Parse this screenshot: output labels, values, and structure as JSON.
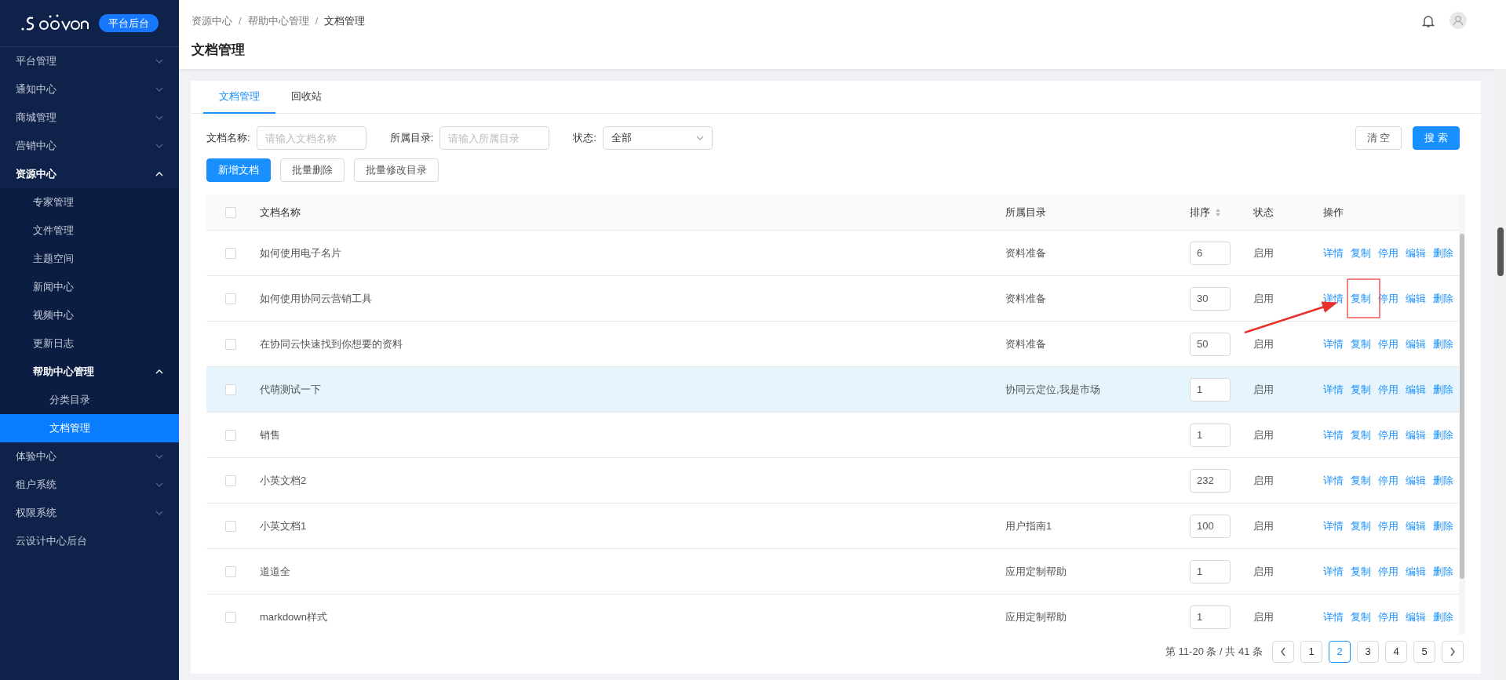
{
  "sidebar": {
    "logo_badge": "平台后台",
    "items": [
      {
        "label": "平台管理",
        "kind": "group",
        "expanded": false
      },
      {
        "label": "通知中心",
        "kind": "group",
        "expanded": false
      },
      {
        "label": "商城管理",
        "kind": "group",
        "expanded": false
      },
      {
        "label": "营销中心",
        "kind": "group",
        "expanded": false
      },
      {
        "label": "资源中心",
        "kind": "group",
        "expanded": true,
        "children": [
          {
            "label": "专家管理",
            "kind": "link",
            "selected": false
          },
          {
            "label": "文件管理",
            "kind": "link",
            "selected": false
          },
          {
            "label": "主题空间",
            "kind": "link",
            "selected": false
          },
          {
            "label": "新闻中心",
            "kind": "link",
            "selected": false
          },
          {
            "label": "视频中心",
            "kind": "link",
            "selected": false
          },
          {
            "label": "更新日志",
            "kind": "link",
            "selected": false
          },
          {
            "label": "帮助中心管理",
            "kind": "group",
            "expanded": true,
            "children": [
              {
                "label": "分类目录",
                "kind": "link",
                "selected": false
              },
              {
                "label": "文档管理",
                "kind": "link",
                "selected": true
              }
            ]
          }
        ]
      },
      {
        "label": "体验中心",
        "kind": "group",
        "expanded": false
      },
      {
        "label": "租户系统",
        "kind": "group",
        "expanded": false
      },
      {
        "label": "权限系统",
        "kind": "group",
        "expanded": false
      },
      {
        "label": "云设计中心后台",
        "kind": "link",
        "selected": false
      }
    ]
  },
  "header": {
    "breadcrumb": [
      "资源中心",
      "帮助中心管理",
      "文档管理"
    ],
    "separator": "/",
    "title": "文档管理"
  },
  "tabs": [
    {
      "label": "文档管理",
      "selected": true
    },
    {
      "label": "回收站",
      "selected": false
    }
  ],
  "filters": [
    {
      "kind": "input",
      "label": "文档名称:",
      "placeholder": "请输入文档名称"
    },
    {
      "kind": "input",
      "label": "所属目录:",
      "placeholder": "请输入所属目录"
    },
    {
      "kind": "select",
      "label": "状态:",
      "value": "全部"
    }
  ],
  "filter_buttons": [
    {
      "label": "清 空",
      "primary": false
    },
    {
      "label": "搜 索",
      "primary": true
    }
  ],
  "toolbar": [
    {
      "label": "新增文档",
      "primary": true
    },
    {
      "label": "批量删除",
      "primary": false
    },
    {
      "label": "批量修改目录",
      "primary": false
    }
  ],
  "table": {
    "columns": [
      "文档名称",
      "所属目录",
      "排序",
      "状态",
      "操作"
    ],
    "header_checked": false,
    "rows": [
      {
        "checked": false,
        "highlighted": false,
        "name": "如何使用电子名片",
        "directory": "资料准备",
        "order": "6",
        "status": "启用",
        "actions": [
          "详情",
          "复制",
          "停用",
          "编辑",
          "删除"
        ]
      },
      {
        "checked": false,
        "highlighted": false,
        "name": "如何使用协同云营销工具",
        "directory": "资料准备",
        "order": "30",
        "status": "启用",
        "actions": [
          "详情",
          "复制",
          "停用",
          "编辑",
          "删除"
        ]
      },
      {
        "checked": false,
        "highlighted": false,
        "name": "在协同云快速找到你想要的资料",
        "directory": "资料准备",
        "order": "50",
        "status": "启用",
        "actions": [
          "详情",
          "复制",
          "停用",
          "编辑",
          "删除"
        ]
      },
      {
        "checked": false,
        "highlighted": true,
        "name": "代萌测试一下",
        "directory": "协同云定位,我是市场",
        "order": "1",
        "status": "启用",
        "actions": [
          "详情",
          "复制",
          "停用",
          "编辑",
          "删除"
        ]
      },
      {
        "checked": false,
        "highlighted": false,
        "name": "销售",
        "order": "1",
        "status": "启用",
        "actions": [
          "详情",
          "复制",
          "停用",
          "编辑",
          "删除"
        ]
      },
      {
        "checked": false,
        "highlighted": false,
        "name": "小英文档2",
        "order": "232",
        "status": "启用",
        "actions": [
          "详情",
          "复制",
          "停用",
          "编辑",
          "删除"
        ]
      },
      {
        "checked": false,
        "highlighted": false,
        "name": "小英文档1",
        "directory": "用户指南1",
        "order": "100",
        "status": "启用",
        "actions": [
          "详情",
          "复制",
          "停用",
          "编辑",
          "删除"
        ]
      },
      {
        "checked": false,
        "highlighted": false,
        "name": "道道全",
        "directory": "应用定制帮助",
        "order": "1",
        "status": "启用",
        "actions": [
          "详情",
          "复制",
          "停用",
          "编辑",
          "删除"
        ]
      },
      {
        "checked": false,
        "highlighted": false,
        "name": "markdown样式",
        "directory": "应用定制帮助",
        "order": "1",
        "status": "启用",
        "actions": [
          "详情",
          "复制",
          "停用",
          "编辑",
          "删除"
        ]
      }
    ]
  },
  "pagination": {
    "summary": "第 11-20 条 / 共 41 条",
    "pages": [
      {
        "label": "1",
        "selected": false
      },
      {
        "label": "2",
        "selected": true
      },
      {
        "label": "3",
        "selected": false
      },
      {
        "label": "4",
        "selected": false
      },
      {
        "label": "5",
        "selected": false
      }
    ]
  }
}
